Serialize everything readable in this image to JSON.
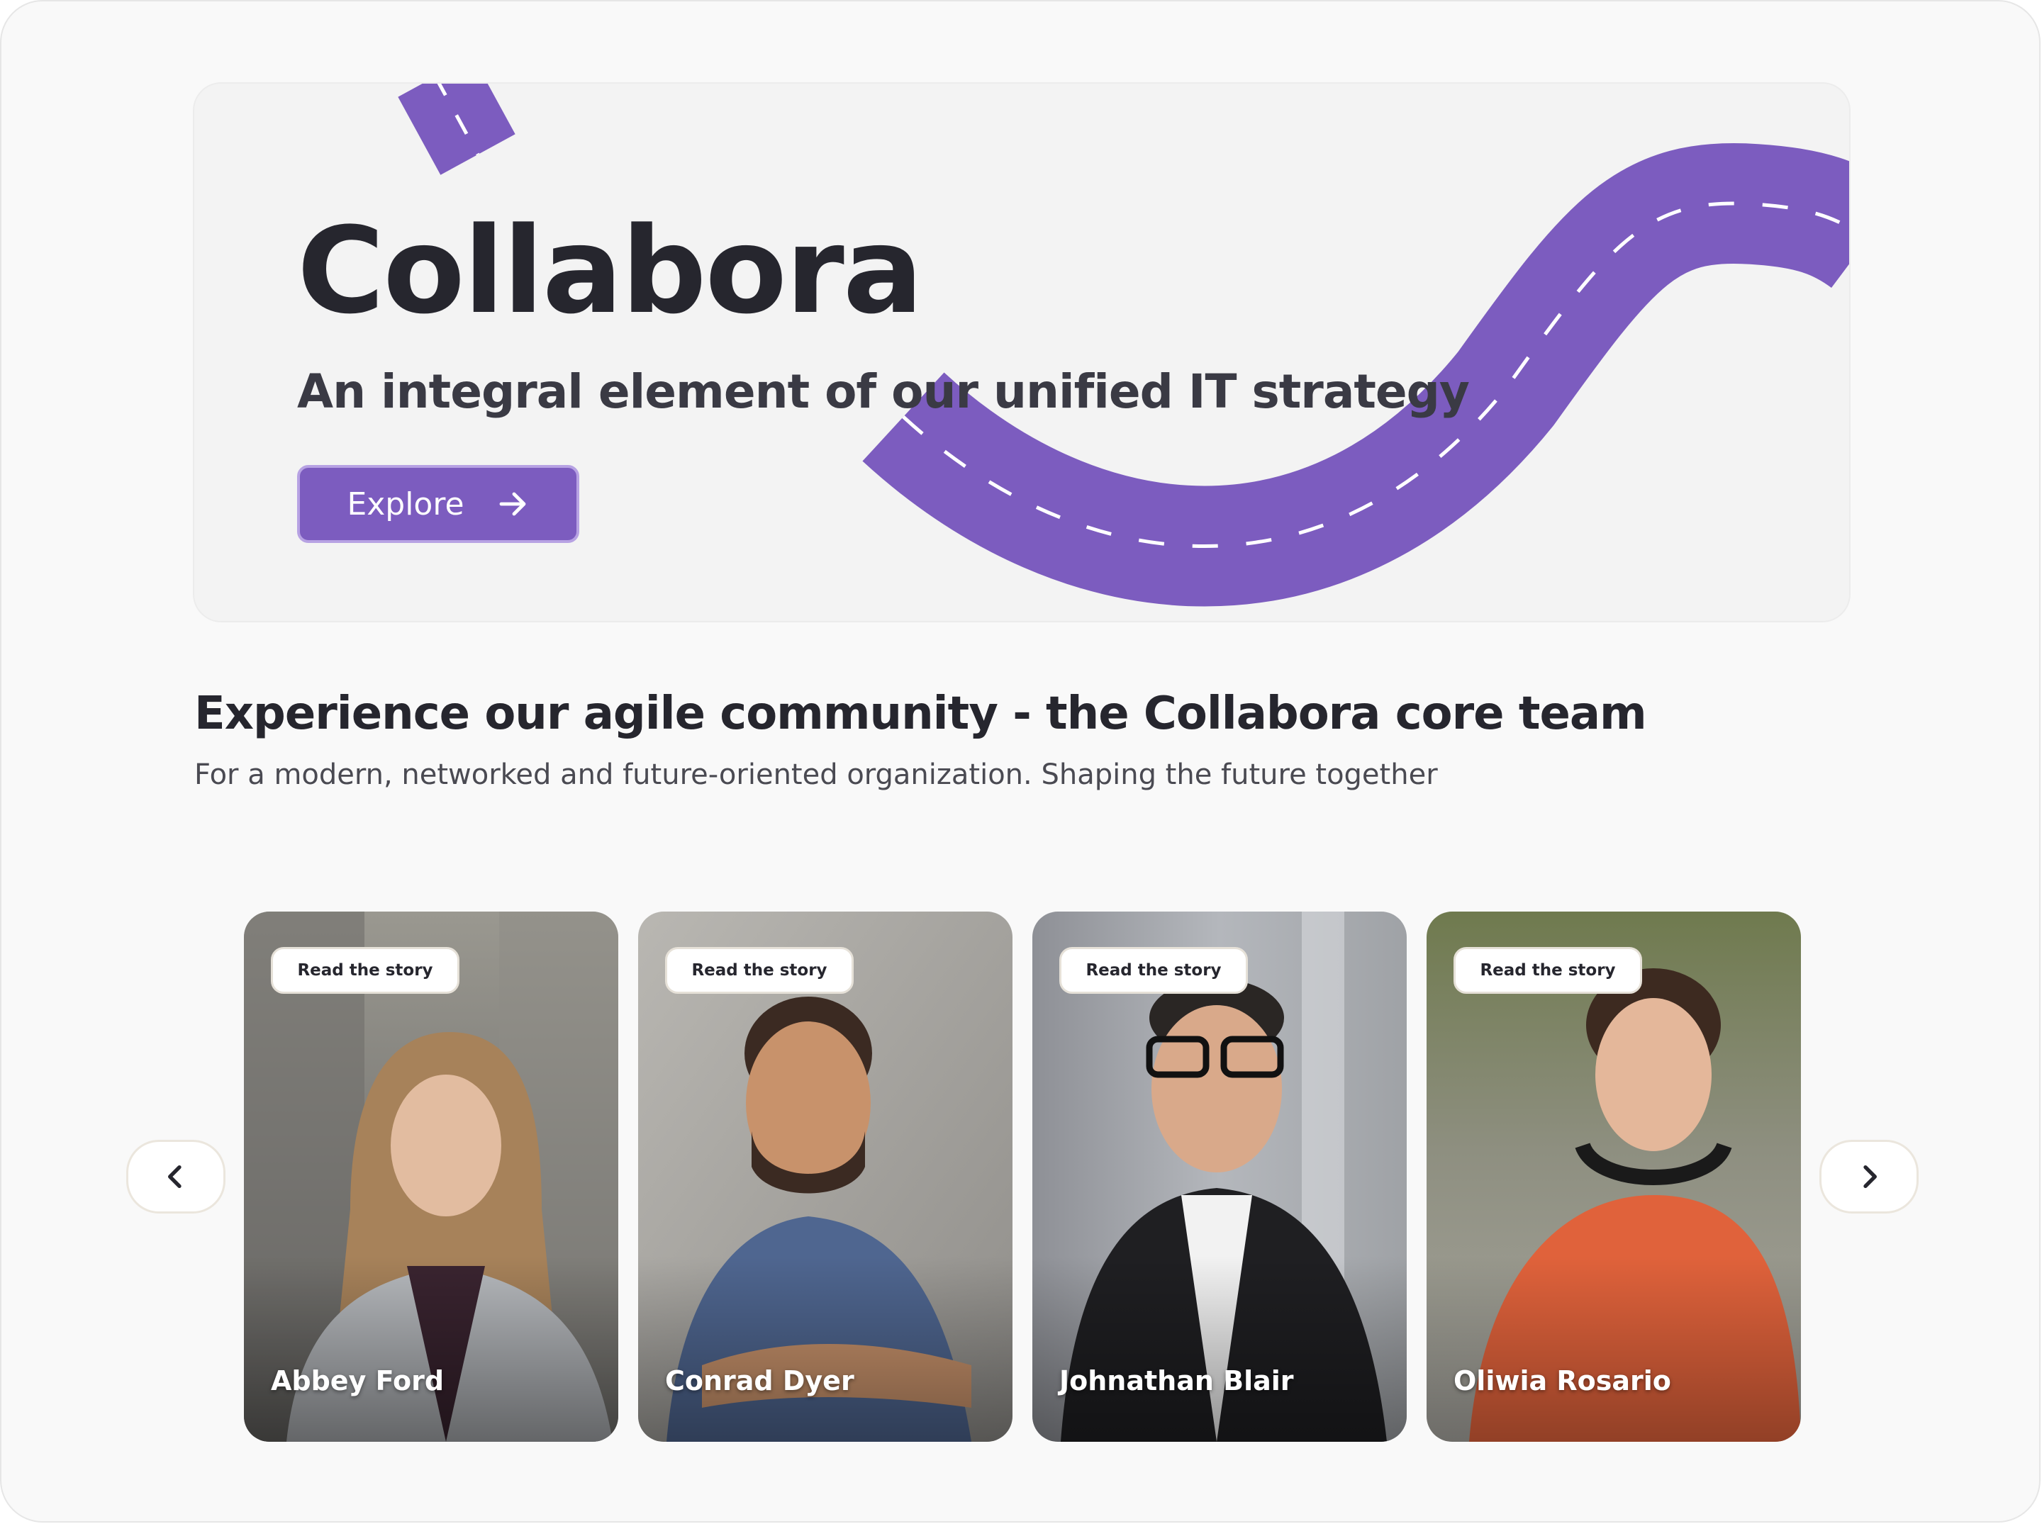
{
  "hero": {
    "title": "Collabora",
    "subtitle": "An integral element of our unified IT strategy",
    "explore_label": "Explore",
    "accent_color": "#7c5cbf"
  },
  "section": {
    "title": "Experience our agile community - the Collabora core team",
    "subtitle": "For a modern, networked and future-oriented organization. Shaping the future together"
  },
  "carousel": {
    "prev_icon": "chevron-left-icon",
    "next_icon": "chevron-right-icon",
    "cards": [
      {
        "story_label": "Read the story",
        "name": "Abbey Ford"
      },
      {
        "story_label": "Read the story",
        "name": "Conrad Dyer"
      },
      {
        "story_label": "Read the story",
        "name": "Johnathan Blair"
      },
      {
        "story_label": "Read the story",
        "name": "Oliwia Rosario"
      }
    ]
  }
}
